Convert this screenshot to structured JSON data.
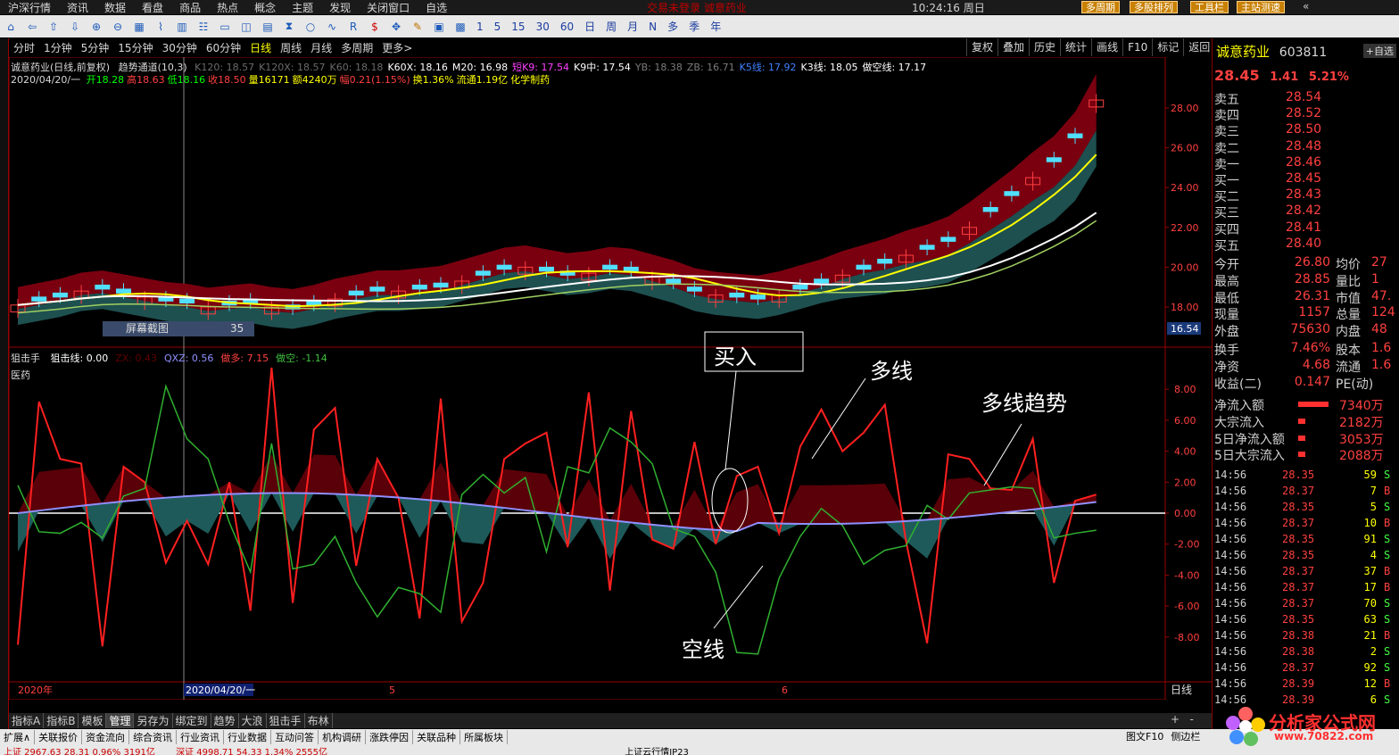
{
  "menu": [
    "沪深行情",
    "资讯",
    "数据",
    "看盘",
    "商品",
    "热点",
    "概念",
    "主题",
    "发现",
    "关闭窗口",
    "自选"
  ],
  "notice": "交易未登录    诚意药业",
  "clock": "10:24:16 周日",
  "top_buttons": [
    "多周期",
    "多股排列",
    "工具栏",
    "主站测速"
  ],
  "toolbar_numbers": [
    "1",
    "5",
    "15",
    "30",
    "60"
  ],
  "toolbar_periods": [
    "日",
    "周",
    "月",
    "N",
    "多",
    "季",
    "年"
  ],
  "periods": [
    "分时",
    "1分钟",
    "5分钟",
    "15分钟",
    "30分钟",
    "60分钟",
    "日线",
    "周线",
    "月线",
    "多周期",
    "更多>"
  ],
  "active_period": "日线",
  "right_buttons": [
    "复权",
    "叠加",
    "历史",
    "统计",
    "画线",
    "F10",
    "标记",
    "返回"
  ],
  "stock": {
    "name": "诚意药业",
    "code": "603811",
    "price": "28.45",
    "change": "1.41",
    "pct": "5.21%",
    "self_btn": "+自选"
  },
  "main_legend": {
    "title": "诚意药业(日线,前复权)",
    "indicator": "趋势通道(10,3)",
    "items": [
      {
        "t": "K120: 18.57",
        "c": "#6a6a6a"
      },
      {
        "t": "K120X: 18.57",
        "c": "#6a6a6a"
      },
      {
        "t": "K60: 18.18",
        "c": "#6a6a6a"
      },
      {
        "t": "K60X: 18.16",
        "c": "#ffffff"
      },
      {
        "t": "M20: 16.98",
        "c": "#ffffff"
      },
      {
        "t": "短K9: 17.54",
        "c": "#ff40ff"
      },
      {
        "t": "K9中: 17.54",
        "c": "#ffffff"
      },
      {
        "t": "YB: 18.38",
        "c": "#7a7a7a"
      },
      {
        "t": "ZB: 16.71",
        "c": "#7a7a7a"
      },
      {
        "t": "K5线: 17.92",
        "c": "#4080ff"
      },
      {
        "t": "K3线: 18.05",
        "c": "#ffffff"
      },
      {
        "t": "做空线: 17.17",
        "c": "#ffffff"
      }
    ]
  },
  "info_line": {
    "date": "2020/04/20/一",
    "items": [
      {
        "t": "开18.28",
        "c": "#00ff00"
      },
      {
        "t": "高18.63",
        "c": "#ff4040"
      },
      {
        "t": "低18.16",
        "c": "#00ff00"
      },
      {
        "t": "收18.50",
        "c": "#ff4040"
      },
      {
        "t": "量16171",
        "c": "#ffff00"
      },
      {
        "t": "额4240万",
        "c": "#ffff00"
      },
      {
        "t": "幅0.21(1.15%)",
        "c": "#ff4040"
      },
      {
        "t": "换1.36%",
        "c": "#ffff00"
      },
      {
        "t": "流通1.19亿",
        "c": "#ffff00"
      },
      {
        "t": "化学制药",
        "c": "#ffff00"
      }
    ]
  },
  "price_axis": [
    "28.00",
    "26.00",
    "24.00",
    "22.00",
    "20.00",
    "18.00"
  ],
  "price_marker": "16.54",
  "screenshot_label": "屏幕截图",
  "screenshot_value": "35",
  "sub_legend": {
    "name": "狙击手",
    "items": [
      {
        "t": "狙击线: 0.00",
        "c": "#ffffff"
      },
      {
        "t": "ZX: 0.43",
        "c": "#600000"
      },
      {
        "t": "QXZ: 0.56",
        "c": "#9090ff"
      },
      {
        "t": "做多: 7.15",
        "c": "#ff4040"
      },
      {
        "t": "做空: -1.14",
        "c": "#40c040"
      }
    ],
    "sector": "医药"
  },
  "sub_axis": [
    "8.00",
    "6.00",
    "4.00",
    "2.00",
    "0.00",
    "-2.00",
    "-4.00",
    "-6.00",
    "-8.00"
  ],
  "date_axis": {
    "year": "2020年",
    "cursor": "2020/04/20/一",
    "m5": "5",
    "m6": "6",
    "mode": "日线"
  },
  "annotations": {
    "buy": "买入",
    "long": "多线",
    "trend": "多线趋势",
    "short": "空线"
  },
  "quote_book": [
    {
      "k": "卖五",
      "v": "28.54"
    },
    {
      "k": "卖四",
      "v": "28.52"
    },
    {
      "k": "卖三",
      "v": "28.50"
    },
    {
      "k": "卖二",
      "v": "28.48"
    },
    {
      "k": "卖一",
      "v": "28.46"
    },
    {
      "k": "买一",
      "v": "28.45"
    },
    {
      "k": "买二",
      "v": "28.43"
    },
    {
      "k": "买三",
      "v": "28.42"
    },
    {
      "k": "买四",
      "v": "28.41"
    },
    {
      "k": "买五",
      "v": "28.40"
    }
  ],
  "quote_stats": [
    {
      "k": "今开",
      "v": "26.80",
      "k2": "均价",
      "v2": "27"
    },
    {
      "k": "最高",
      "v": "28.85",
      "k2": "量比",
      "v2": "1"
    },
    {
      "k": "最低",
      "v": "26.31",
      "k2": "市值",
      "v2": "47."
    },
    {
      "k": "现量",
      "v": "1157",
      "k2": "总量",
      "v2": "124"
    },
    {
      "k": "外盘",
      "v": "75630",
      "k2": "内盘",
      "v2": "48"
    },
    {
      "k": "换手",
      "v": "7.46%",
      "k2": "股本",
      "v2": "1.6"
    },
    {
      "k": "净资",
      "v": "4.68",
      "k2": "流通",
      "v2": "1.6"
    },
    {
      "k": "收益(二)",
      "v": "0.147",
      "k2": "PE(动)",
      "v2": ""
    }
  ],
  "flows": [
    {
      "k": "净流入额",
      "v": "7340万"
    },
    {
      "k": "大宗流入",
      "v": "2182万"
    },
    {
      "k": "5日净流入额",
      "v": "3053万"
    },
    {
      "k": "5日大宗流入",
      "v": "2088万"
    }
  ],
  "ticks": [
    {
      "t": "14:56",
      "p": "28.35",
      "v": "59",
      "s": "S"
    },
    {
      "t": "14:56",
      "p": "28.37",
      "v": "7",
      "s": "B"
    },
    {
      "t": "14:56",
      "p": "28.35",
      "v": "5",
      "s": "S"
    },
    {
      "t": "14:56",
      "p": "28.37",
      "v": "10",
      "s": "B"
    },
    {
      "t": "14:56",
      "p": "28.35",
      "v": "91",
      "s": "S"
    },
    {
      "t": "14:56",
      "p": "28.35",
      "v": "4",
      "s": "S"
    },
    {
      "t": "14:56",
      "p": "28.37",
      "v": "37",
      "s": "B"
    },
    {
      "t": "14:56",
      "p": "28.37",
      "v": "17",
      "s": "B"
    },
    {
      "t": "14:56",
      "p": "28.37",
      "v": "70",
      "s": "S"
    },
    {
      "t": "14:56",
      "p": "28.35",
      "v": "63",
      "s": "S"
    },
    {
      "t": "14:56",
      "p": "28.38",
      "v": "21",
      "s": "B"
    },
    {
      "t": "14:56",
      "p": "28.38",
      "v": "2",
      "s": "S"
    },
    {
      "t": "14:56",
      "p": "28.37",
      "v": "92",
      "s": "S"
    },
    {
      "t": "14:56",
      "p": "28.39",
      "v": "12",
      "s": "B"
    },
    {
      "t": "14:56",
      "p": "28.39",
      "v": "6",
      "s": "S"
    }
  ],
  "tabs": [
    "指标A",
    "指标B",
    "模板",
    "管理",
    "另存为",
    "绑定到",
    "趋势",
    "大浪",
    "狙击手",
    "布林"
  ],
  "active_tab": "管理",
  "bottom_tabs": [
    "扩展∧",
    "关联报价",
    "资金流向",
    "综合资讯",
    "行业资讯",
    "行业数据",
    "互动问答",
    "机构调研",
    "涨跌停因",
    "关联品种",
    "所属板块"
  ],
  "bottom_right": [
    "图文F10",
    "侧边栏"
  ],
  "status": {
    "sh": "上证 2967.63  28.31  0.96%  3191亿",
    "sz": "深证 4998.71  54.33  1.34%  2555亿",
    "extra": "上证云行情IP23"
  },
  "watermark": {
    "cn": "分析家公式网",
    "url": "www.70822.com"
  }
}
